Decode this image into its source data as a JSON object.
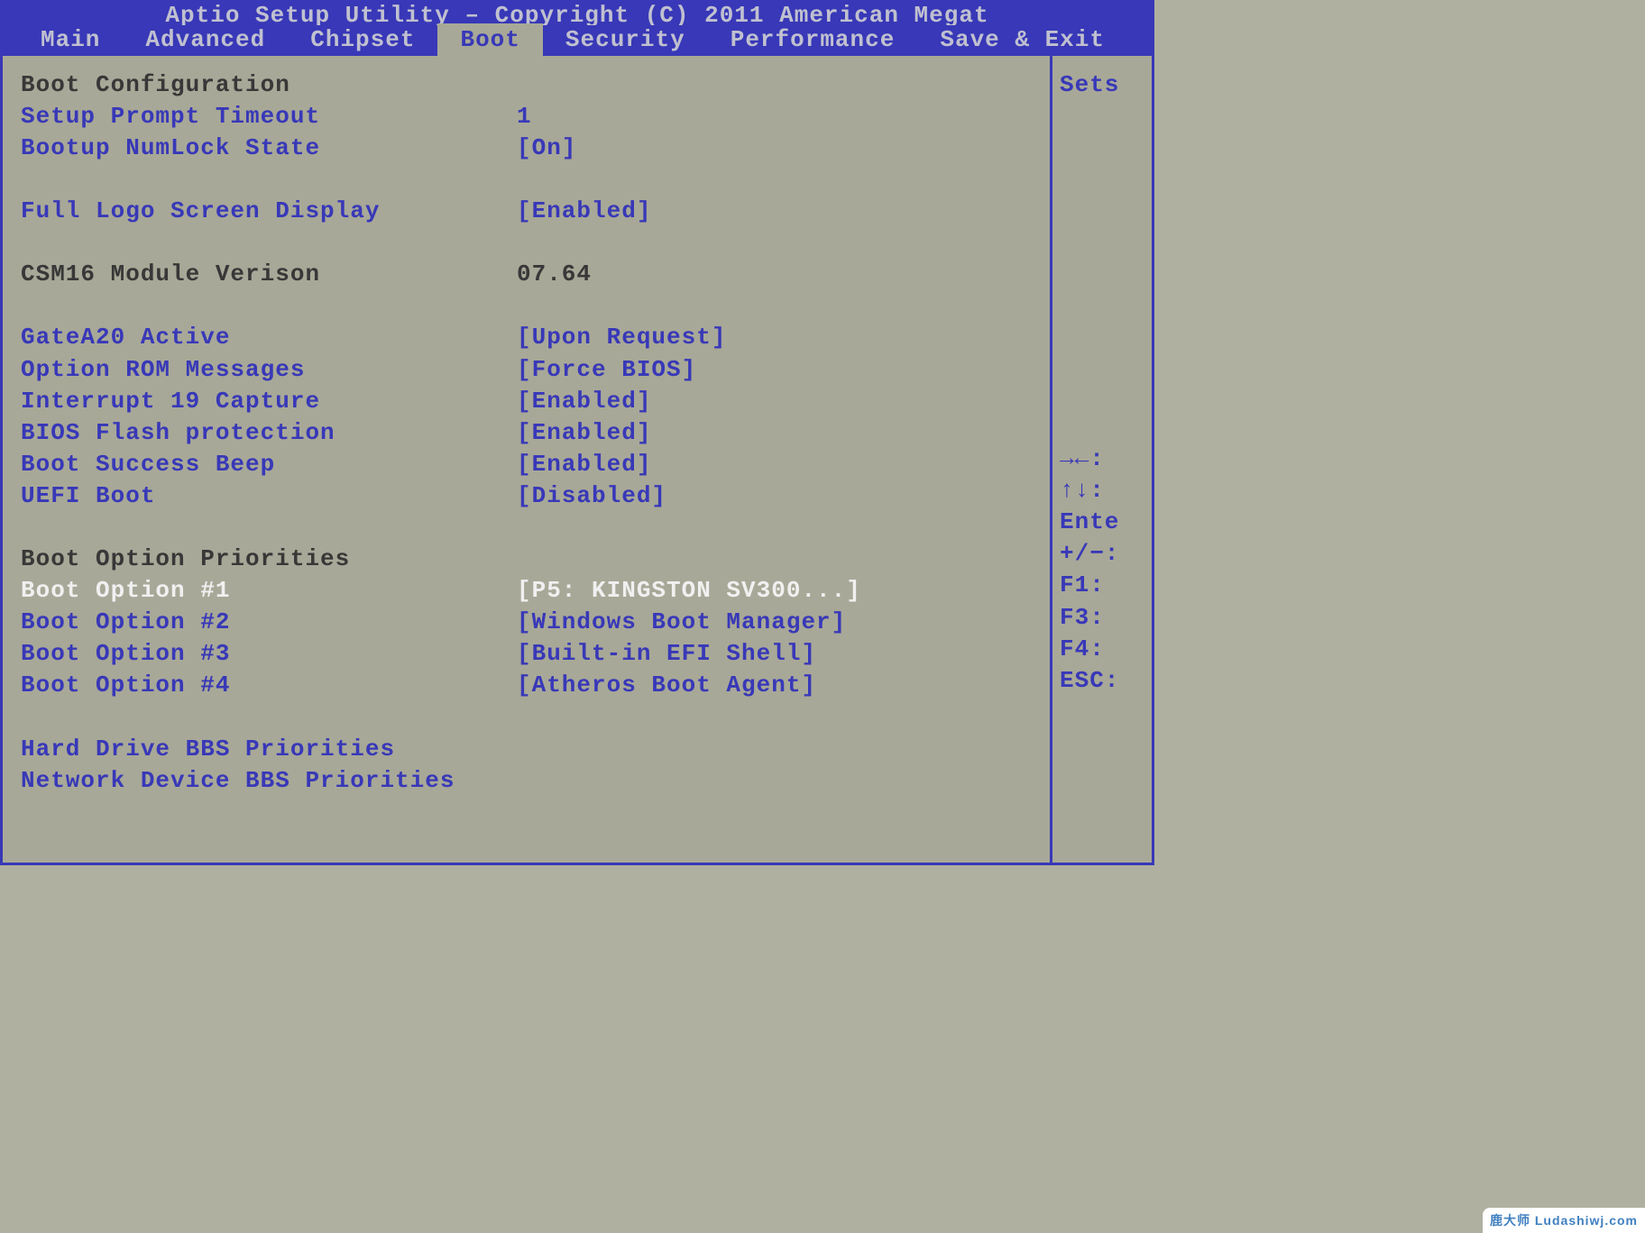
{
  "header": {
    "title": "Aptio Setup Utility – Copyright (C) 2011 American Megat"
  },
  "tabs": [
    {
      "label": "Main",
      "active": false
    },
    {
      "label": "Advanced",
      "active": false
    },
    {
      "label": "Chipset",
      "active": false
    },
    {
      "label": "Boot",
      "active": true
    },
    {
      "label": "Security",
      "active": false
    },
    {
      "label": "Performance",
      "active": false
    },
    {
      "label": "Save & Exit",
      "active": false
    }
  ],
  "sections": {
    "boot_config_heading": "Boot Configuration",
    "setup_prompt_timeout": {
      "label": "Setup Prompt Timeout",
      "value": "1"
    },
    "bootup_numlock": {
      "label": "Bootup NumLock State",
      "value": "[On]"
    },
    "full_logo": {
      "label": "Full Logo Screen Display",
      "value": "[Enabled]"
    },
    "csm16": {
      "label": "CSM16 Module Verison",
      "value": "07.64"
    },
    "gatea20": {
      "label": "GateA20 Active",
      "value": "[Upon Request]"
    },
    "option_rom": {
      "label": "Option ROM Messages",
      "value": "[Force BIOS]"
    },
    "int19": {
      "label": "Interrupt 19 Capture",
      "value": "[Enabled]"
    },
    "flash_protect": {
      "label": "BIOS Flash protection",
      "value": "[Enabled]"
    },
    "boot_beep": {
      "label": "Boot Success Beep",
      "value": "[Enabled]"
    },
    "uefi_boot": {
      "label": "UEFI Boot",
      "value": "[Disabled]"
    },
    "priorities_heading": "Boot Option Priorities",
    "boot1": {
      "label": "Boot Option #1",
      "value": "[P5: KINGSTON SV300...]"
    },
    "boot2": {
      "label": "Boot Option #2",
      "value": "[Windows Boot Manager]"
    },
    "boot3": {
      "label": "Boot Option #3",
      "value": "[Built-in EFI Shell]"
    },
    "boot4": {
      "label": "Boot Option #4",
      "value": "[Atheros Boot Agent]"
    },
    "hdd_bbs": "Hard Drive BBS Priorities",
    "net_bbs": "Network Device BBS Priorities"
  },
  "help": {
    "top": "Sets",
    "keys": [
      "→←:",
      "↑↓:",
      "Ente",
      "+/−:",
      "F1:",
      "F3:",
      "F4:",
      "ESC:"
    ]
  },
  "watermark": "鹿大师 Ludashiwj.com"
}
